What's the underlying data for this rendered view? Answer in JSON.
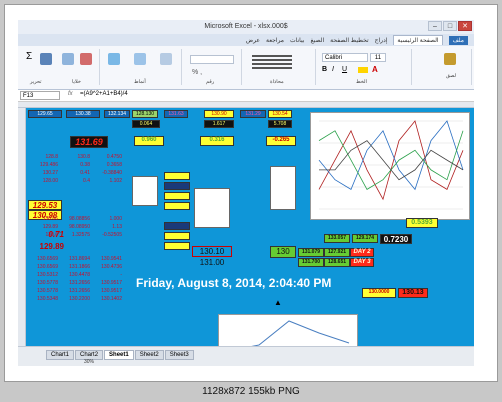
{
  "window": {
    "title": "Microsoft Excel - xlsx.000$",
    "min": "–",
    "max": "□",
    "close": "✕"
  },
  "tabs": [
    "ملف",
    "الصفحة الرئيسية",
    "إدراج",
    "تخطيط الصفحة",
    "الصيغ",
    "بيانات",
    "مراجعة",
    "عرض"
  ],
  "ribbon": {
    "font_name": "Calibri",
    "font_size": "11",
    "groups": [
      "لصق",
      "الخط",
      "محاذاة",
      "رقم",
      "أنماط",
      "خلايا",
      "تحرير"
    ]
  },
  "formula_bar": {
    "name_box": "F13",
    "fx": "fx",
    "formula": "=(A9^2+A1+B4)/4"
  },
  "sheet": {
    "row1": [
      "129.65",
      "130.38",
      "132.134",
      "128.130",
      "131.63",
      "130.90",
      "131.29",
      "130.54"
    ],
    "row2": [
      "0.064",
      "1.617",
      "5.708"
    ],
    "big_red": "131.69",
    "yellow_vals": [
      "0.960",
      "0.316",
      "-0.265"
    ],
    "right_green": "0.5393",
    "left_col": [
      "129.53",
      "130.98"
    ],
    "red_vals": [
      "0.71",
      "129.89"
    ],
    "mid_vals": [
      "130.10",
      "131.00"
    ],
    "green_cells": [
      "130",
      "131.079",
      "127.921",
      "131.700",
      "128.651"
    ],
    "right_cells": [
      "133.057",
      "129.174",
      "0.7230"
    ],
    "day_labels": [
      "DAY 2",
      "DAY 3"
    ],
    "small_rows": [
      [
        "128.8",
        "130.8",
        "0.4750"
      ],
      [
        "129.486",
        "0.38",
        "0.3658"
      ],
      [
        "130.27",
        "0.41",
        "-0.38840"
      ],
      [
        "128.00",
        "0.4",
        "1.102"
      ],
      [
        "130.66",
        "98.08856",
        "1.000"
      ],
      [
        "129.89",
        "98.08950",
        "1.13"
      ],
      [
        "130.6",
        "1.32575",
        "-0.52505"
      ],
      [
        "130.6569",
        "131.8694",
        "130.9541"
      ],
      [
        "130.6569",
        "131.1866",
        "130.4736"
      ],
      [
        "130.5312",
        "130.4478",
        "-"
      ],
      [
        "130.5778",
        "131.2656",
        "130.9517"
      ],
      [
        "130.5778",
        "131.2656",
        "130.9517"
      ],
      [
        "130.5348",
        "130.2200",
        "130.1402"
      ]
    ],
    "datetime": "Friday, August 8, 2014, 2:04:40 PM",
    "red_box": [
      "130.0000",
      "130.13"
    ]
  },
  "sheet_tabs": [
    "Chart1",
    "Chart2",
    "Sheet1",
    "Sheet2",
    "Sheet3"
  ],
  "active_sheet": "Sheet1",
  "zoom": "30%",
  "footer_caption": "1128x872  155kb  PNG",
  "colors": {
    "sheet_bg": "#0f96d8",
    "yellow": "#ffff33",
    "green": "#66cc33",
    "red": "#ff2a1a",
    "dark": "#111111"
  },
  "chart_data": {
    "type": "line",
    "series": [
      {
        "values": [
          2,
          5,
          8,
          4,
          1,
          7,
          9,
          3,
          2,
          6
        ]
      },
      {
        "values": [
          5,
          3,
          2,
          6,
          8,
          4,
          2,
          7,
          9,
          4
        ]
      },
      {
        "values": [
          7,
          8,
          5,
          2,
          3,
          5,
          6,
          4,
          3,
          8
        ]
      },
      {
        "values": [
          4,
          4,
          6,
          7,
          5,
          3,
          4,
          6,
          5,
          4
        ]
      }
    ]
  }
}
